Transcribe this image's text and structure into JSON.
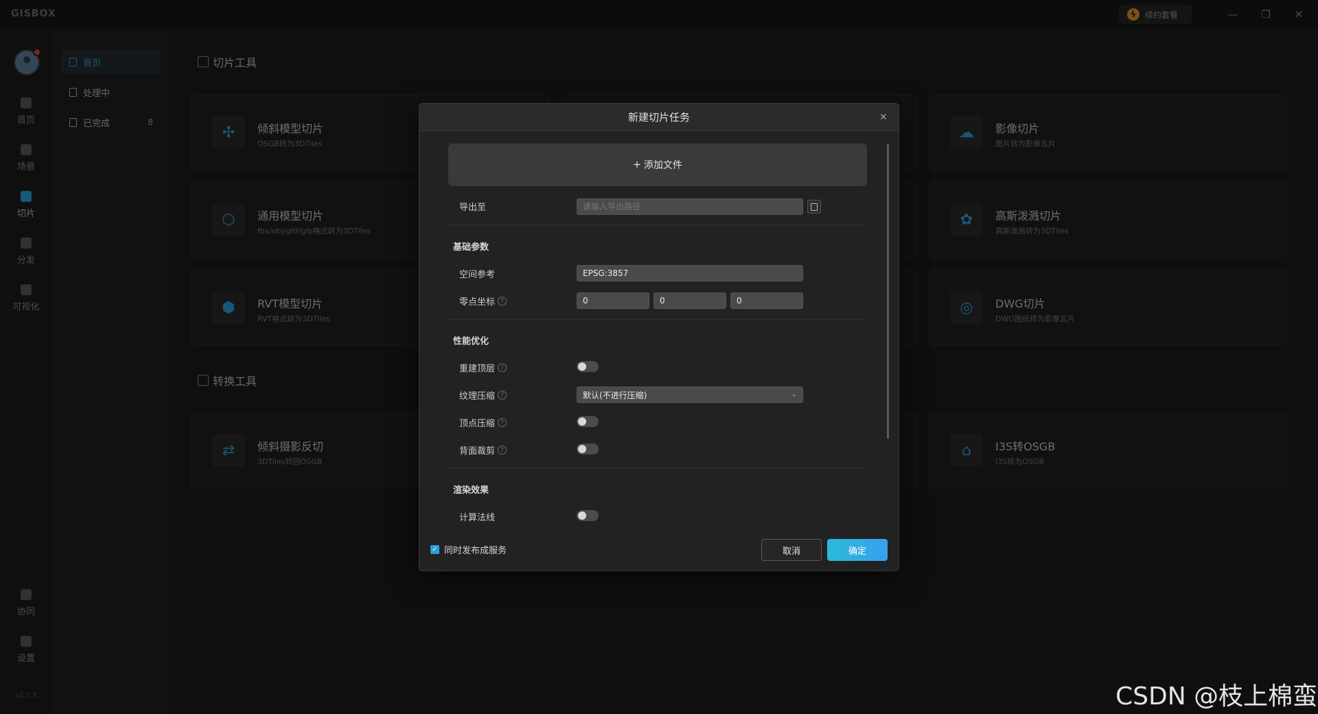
{
  "app": {
    "logo": "GISBOX",
    "subscription": "续约套餐",
    "version": "v1.2.5",
    "window": {
      "minimize": "—",
      "restore": "❐",
      "close": "✕"
    }
  },
  "rail": {
    "items": [
      {
        "label": "首页",
        "icon": "home-icon"
      },
      {
        "label": "场景",
        "icon": "scene-icon"
      },
      {
        "label": "切片",
        "icon": "slice-icon"
      },
      {
        "label": "分发",
        "icon": "distribute-icon"
      },
      {
        "label": "可视化",
        "icon": "visualize-icon"
      }
    ],
    "bottom": [
      {
        "label": "协同",
        "icon": "collab-icon"
      },
      {
        "label": "设置",
        "icon": "settings-icon"
      }
    ]
  },
  "subnav": {
    "items": [
      {
        "label": "首页"
      },
      {
        "label": "处理中"
      },
      {
        "label": "已完成",
        "count": "8"
      }
    ]
  },
  "content": {
    "slice_section": "切片工具",
    "convert_section": "转换工具",
    "cards": [
      {
        "title": "倾斜模型切片",
        "desc": "OSGB转为3DTiles",
        "icon": "drone-icon"
      },
      {
        "title": "通用模型切片",
        "desc": "fbx/obj/gltf/glb格式转为3DTiles",
        "icon": "cube-icon"
      },
      {
        "title": "RVT模型切片",
        "desc": "RVT格式转为3DTiles",
        "icon": "rvt-icon"
      },
      {
        "title": "影像切片",
        "desc": "图片转为影像瓦片",
        "icon": "cloud-icon"
      },
      {
        "title": "高斯泼溅切片",
        "desc": "高斯泼溅转为3DTiles",
        "icon": "gauss-icon"
      },
      {
        "title": "DWG切片",
        "desc": "DWG图纸转为影像瓦片",
        "icon": "dwg-icon"
      },
      {
        "title": "倾斜摄影反切",
        "desc": "3DTiles转回OSGB",
        "icon": "reverse-icon"
      },
      {
        "title": "I3S转OSGB",
        "desc": "I3S转为OSGB",
        "icon": "i3s-icon"
      }
    ]
  },
  "modal": {
    "title": "新建切片任务",
    "add_file": "添加文件",
    "export_label": "导出至",
    "export_placeholder": "请输入导出路径",
    "group_basic": "基础参数",
    "spatial_ref_label": "空间参考",
    "spatial_ref_value": "EPSG:3857",
    "origin_label": "零点坐标",
    "origin_values": [
      "0",
      "0",
      "0"
    ],
    "group_perf": "性能优化",
    "rebuild_top_label": "重建顶层",
    "texture_label": "纹理压缩",
    "texture_value": "默认(不进行压缩)",
    "vertex_label": "顶点压缩",
    "backface_label": "背面裁剪",
    "group_render": "渲染效果",
    "normals_label": "计算法线",
    "publish_label": "同时发布成服务",
    "cancel": "取消",
    "ok": "确定"
  },
  "watermark": "CSDN @枝上棉蛮"
}
